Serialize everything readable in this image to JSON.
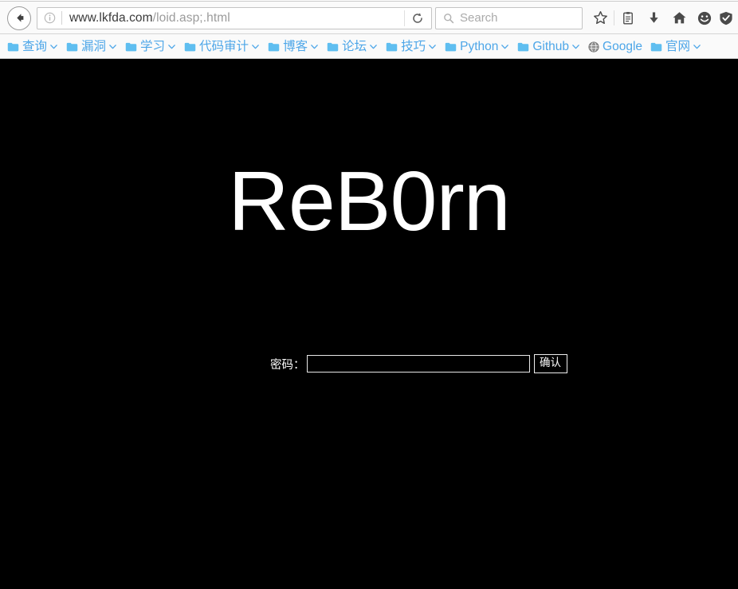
{
  "browser": {
    "back_button_label": "Back",
    "url": {
      "host": "www.lkfda.com",
      "path": "/loid.asp;.html",
      "full": "www.lkfda.com/loid.asp;.html"
    },
    "reload_label": "Reload",
    "search": {
      "placeholder": "Search",
      "value": ""
    },
    "toolbar_icons": [
      {
        "name": "bookmark-star-icon",
        "label": "Bookmark this page"
      },
      {
        "name": "library-icon",
        "label": "Show your library"
      },
      {
        "name": "download-icon",
        "label": "Downloads"
      },
      {
        "name": "home-icon",
        "label": "Home"
      },
      {
        "name": "pocket-icon",
        "label": "Save to Pocket"
      },
      {
        "name": "shield-icon",
        "label": "Protection"
      }
    ],
    "bookmarks": [
      {
        "label": "查询",
        "icon": "folder-icon",
        "chevron": true
      },
      {
        "label": "漏洞",
        "icon": "folder-icon",
        "chevron": true
      },
      {
        "label": "学习",
        "icon": "folder-icon",
        "chevron": true
      },
      {
        "label": "代码审计",
        "icon": "folder-icon",
        "chevron": true
      },
      {
        "label": "博客",
        "icon": "folder-icon",
        "chevron": true
      },
      {
        "label": "论坛",
        "icon": "folder-icon",
        "chevron": true
      },
      {
        "label": "技巧",
        "icon": "folder-icon",
        "chevron": true
      },
      {
        "label": "Python",
        "icon": "folder-icon",
        "chevron": true
      },
      {
        "label": "Github",
        "icon": "folder-icon",
        "chevron": true
      },
      {
        "label": "Google",
        "icon": "globe-icon",
        "chevron": false
      },
      {
        "label": "官网",
        "icon": "folder-icon",
        "chevron": true
      }
    ]
  },
  "page": {
    "heading": "ReB0rn",
    "form": {
      "password_label": "密码：",
      "password_value": "",
      "password_placeholder": "",
      "submit_label": "确认"
    },
    "colors": {
      "background": "#000000",
      "text": "#ffffff",
      "bookmark_text": "#4da6e8"
    }
  }
}
